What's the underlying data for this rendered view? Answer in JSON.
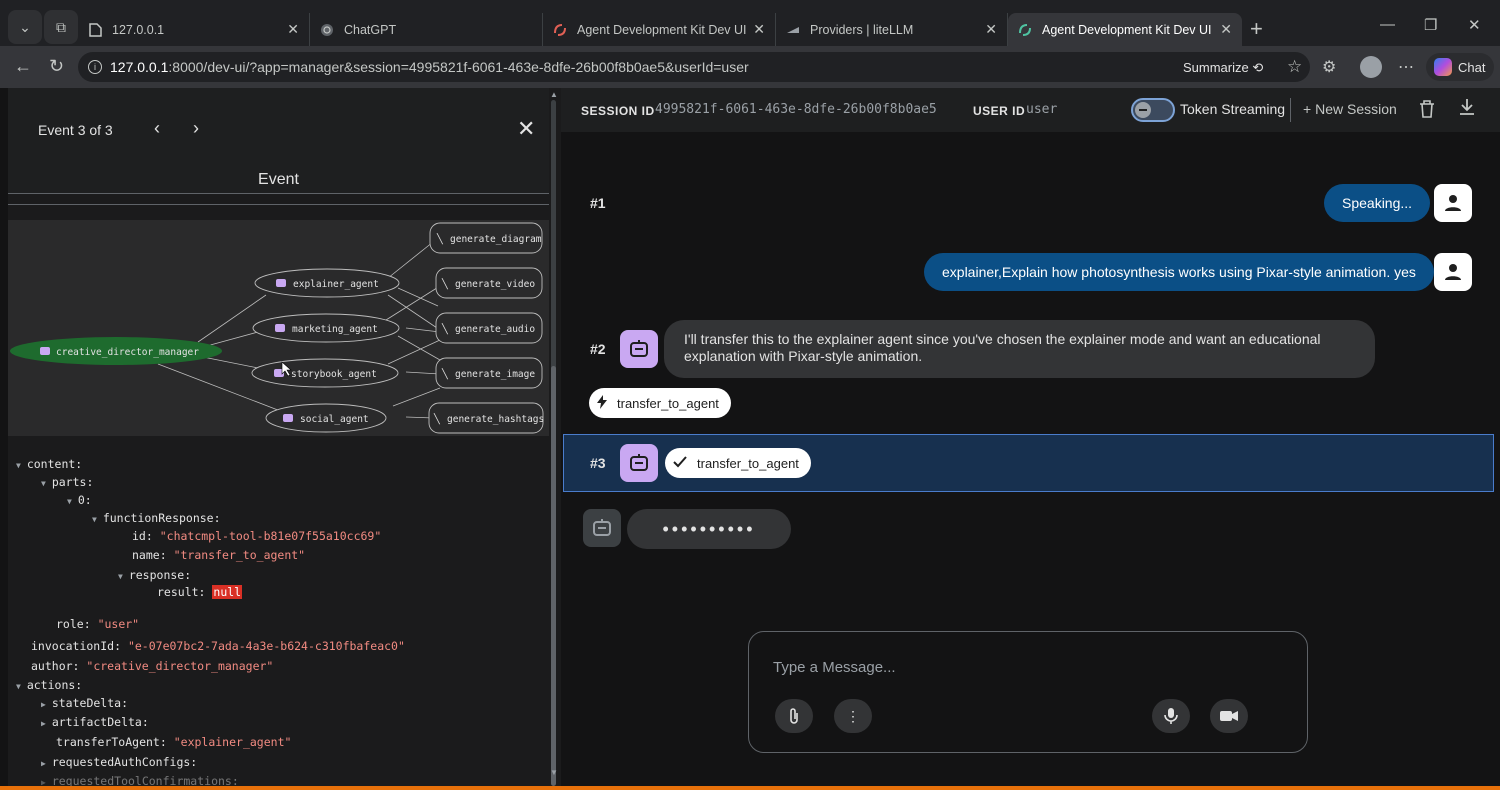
{
  "browser": {
    "tabs": [
      {
        "title": "127.0.0.1",
        "active": false
      },
      {
        "title": "ChatGPT",
        "active": false
      },
      {
        "title": "Agent Development Kit Dev UI",
        "active": false
      },
      {
        "title": "Providers | liteLLM",
        "active": false
      },
      {
        "title": "Agent Development Kit Dev UI",
        "active": true
      }
    ],
    "url_host": "127.0.0.1",
    "url_rest": ":8000/dev-ui/?app=manager&session=4995821f-6061-463e-8dfe-26b00f8b0ae5&userId=user",
    "summarize_label": "Summarize",
    "chat_label": "Chat"
  },
  "event_panel": {
    "counter": "Event 3 of 3",
    "title": "Event",
    "graph": {
      "root": "creative_director_manager",
      "agents": [
        "explainer_agent",
        "marketing_agent",
        "storybook_agent",
        "social_agent"
      ],
      "tools": [
        "generate_diagram",
        "generate_video",
        "generate_audio",
        "generate_image",
        "generate_hashtags"
      ]
    },
    "json": {
      "content_key": "content:",
      "parts_key": "parts:",
      "index_key": "0:",
      "fr_key": "functionResponse:",
      "id_key": "id:",
      "id_val": "\"chatcmpl-tool-b81e07f55a10cc69\"",
      "name_key": "name:",
      "name_val": "\"transfer_to_agent\"",
      "response_key": "response:",
      "result_key": "result:",
      "result_val": "null",
      "role_key": "role:",
      "role_val": "\"user\"",
      "inv_key": "invocationId:",
      "inv_val": "\"e-07e07bc2-7ada-4a3e-b624-c310fbafeac0\"",
      "author_key": "author:",
      "author_val": "\"creative_director_manager\"",
      "actions_key": "actions:",
      "state_key": "stateDelta:",
      "artifact_key": "artifactDelta:",
      "transfer_key": "transferToAgent:",
      "transfer_val": "\"explainer_agent\"",
      "auth_key": "requestedAuthConfigs:",
      "confirm_key": "requestedToolConfirmations:"
    }
  },
  "chat": {
    "session_label": "SESSION ID",
    "session_id": "4995821f-6061-463e-8dfe-26b00f8b0ae5",
    "user_label": "USER ID",
    "user_id": "user",
    "token_streaming": "Token Streaming",
    "new_session": "New Session",
    "turns": {
      "t1": "#1",
      "t2": "#2",
      "t3": "#3"
    },
    "msg_speaking": "Speaking...",
    "msg_user": "explainer,Explain how photosynthesis works using Pixar-style animation. yes",
    "msg_bot_line1": "I'll transfer this to the explainer agent since you've chosen the explainer mode and want an educational",
    "msg_bot_line2": "explanation with Pixar-style animation.",
    "call_pill": "transfer_to_agent",
    "response_pill": "transfer_to_agent",
    "loading": "••••••••••",
    "input_placeholder": "Type a Message..."
  }
}
